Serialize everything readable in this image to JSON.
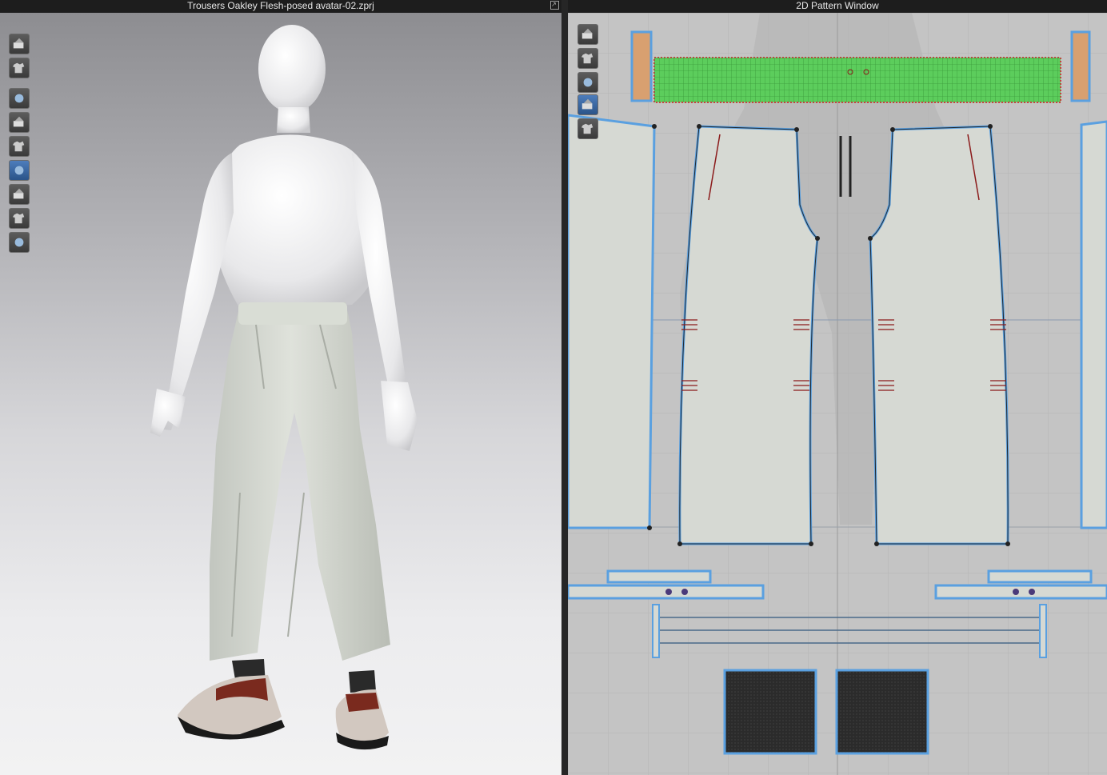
{
  "windows": {
    "left_title": "Trousers Oakley Flesh-posed avatar-02.zprj",
    "right_title": "2D Pattern Window"
  },
  "toolbar_3d": [
    {
      "icon": "display-avatar-icon"
    },
    {
      "icon": "show-garment-icon"
    },
    {
      "icon": "garment-display-mode-icon"
    },
    {
      "icon": "texture-display-icon"
    },
    {
      "icon": "avatar-display-icon"
    },
    {
      "icon": "fabric-display-icon"
    },
    {
      "icon": "shading-icon"
    },
    {
      "icon": "avatar-skin-icon"
    },
    {
      "icon": "environment-icon"
    }
  ],
  "toolbar_2d": [
    {
      "icon": "pattern-display-icon"
    },
    {
      "icon": "show-pattern-icon"
    },
    {
      "icon": "info-icon"
    },
    {
      "icon": "texture-2d-icon"
    },
    {
      "icon": "lock-pattern-icon"
    }
  ],
  "colors": {
    "pattern_fill": "#d6d9d3",
    "pattern_outline": "#5aa0e0",
    "waistband_fill": "#5ccd5c",
    "bg_2d": "#c4c4c4",
    "garment": "#d7dbd3"
  }
}
